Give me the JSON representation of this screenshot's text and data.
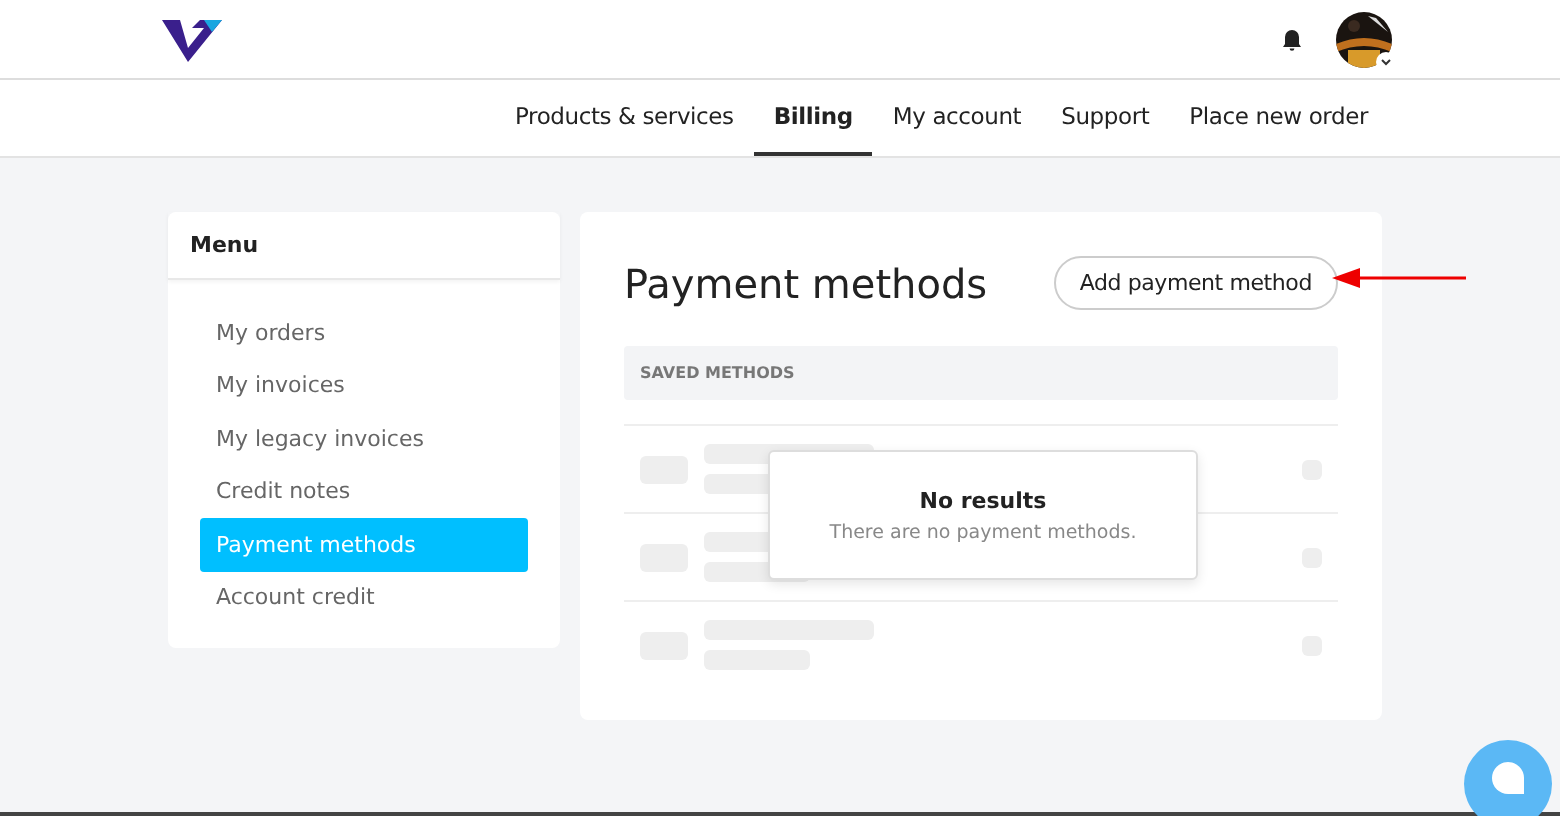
{
  "nav": [
    {
      "label": "Products & services",
      "selected": false
    },
    {
      "label": "Billing",
      "selected": true
    },
    {
      "label": "My account",
      "selected": false
    },
    {
      "label": "Support",
      "selected": false
    },
    {
      "label": "Place new order",
      "selected": false
    }
  ],
  "sidebar": {
    "title": "Menu",
    "items": [
      {
        "label": "My orders",
        "selected": false
      },
      {
        "label": "My invoices",
        "selected": false
      },
      {
        "label": "My legacy invoices",
        "selected": false
      },
      {
        "label": "Credit notes",
        "selected": false
      },
      {
        "label": "Payment methods",
        "selected": true
      },
      {
        "label": "Account credit",
        "selected": false
      }
    ]
  },
  "main": {
    "title": "Payment methods",
    "add_button": "Add payment method",
    "table_header": "SAVED METHODS",
    "empty": {
      "title": "No results",
      "message": "There are no payment methods."
    }
  }
}
